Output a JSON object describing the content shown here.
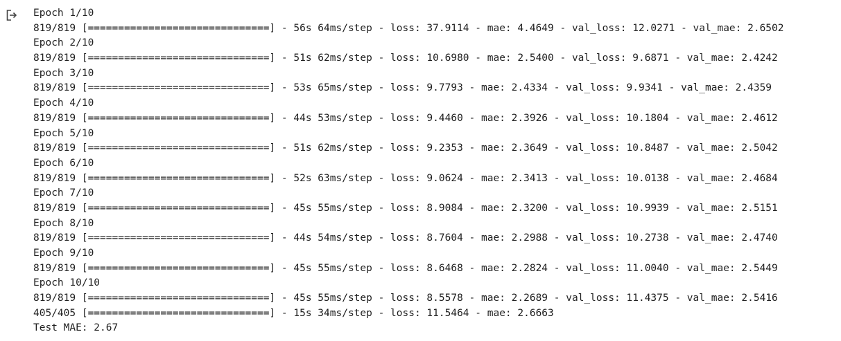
{
  "output": {
    "icon": "output-redirect-icon",
    "lines": [
      "Epoch 1/10",
      "819/819 [==============================] - 56s 64ms/step - loss: 37.9114 - mae: 4.4649 - val_loss: 12.0271 - val_mae: 2.6502",
      "Epoch 2/10",
      "819/819 [==============================] - 51s 62ms/step - loss: 10.6980 - mae: 2.5400 - val_loss: 9.6871 - val_mae: 2.4242",
      "Epoch 3/10",
      "819/819 [==============================] - 53s 65ms/step - loss: 9.7793 - mae: 2.4334 - val_loss: 9.9341 - val_mae: 2.4359",
      "Epoch 4/10",
      "819/819 [==============================] - 44s 53ms/step - loss: 9.4460 - mae: 2.3926 - val_loss: 10.1804 - val_mae: 2.4612",
      "Epoch 5/10",
      "819/819 [==============================] - 51s 62ms/step - loss: 9.2353 - mae: 2.3649 - val_loss: 10.8487 - val_mae: 2.5042",
      "Epoch 6/10",
      "819/819 [==============================] - 52s 63ms/step - loss: 9.0624 - mae: 2.3413 - val_loss: 10.0138 - val_mae: 2.4684",
      "Epoch 7/10",
      "819/819 [==============================] - 45s 55ms/step - loss: 8.9084 - mae: 2.3200 - val_loss: 10.9939 - val_mae: 2.5151",
      "Epoch 8/10",
      "819/819 [==============================] - 44s 54ms/step - loss: 8.7604 - mae: 2.2988 - val_loss: 10.2738 - val_mae: 2.4740",
      "Epoch 9/10",
      "819/819 [==============================] - 45s 55ms/step - loss: 8.6468 - mae: 2.2824 - val_loss: 11.0040 - val_mae: 2.5449",
      "Epoch 10/10",
      "819/819 [==============================] - 45s 55ms/step - loss: 8.5578 - mae: 2.2689 - val_loss: 11.4375 - val_mae: 2.5416",
      "405/405 [==============================] - 15s 34ms/step - loss: 11.5464 - mae: 2.6663",
      "Test MAE: 2.67"
    ]
  }
}
